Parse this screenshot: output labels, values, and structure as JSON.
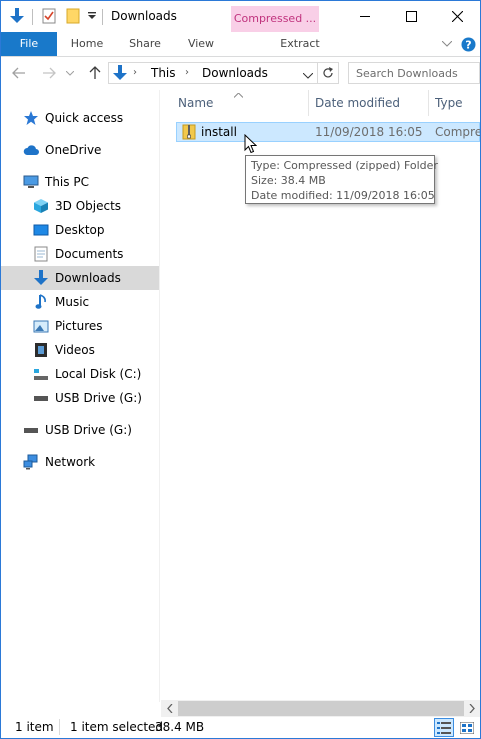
{
  "window": {
    "title": "Downloads"
  },
  "ribbon": {
    "context_tab": "Compressed ...",
    "tabs": [
      {
        "label": "File"
      },
      {
        "label": "Home"
      },
      {
        "label": "Share"
      },
      {
        "label": "View"
      },
      {
        "label": "Extract"
      }
    ]
  },
  "address": {
    "crumbs": [
      "This",
      "Downloads"
    ]
  },
  "search": {
    "placeholder": "Search Downloads"
  },
  "nav": {
    "items": [
      {
        "label": "Quick access",
        "icon": "star-icon"
      },
      {
        "label": "OneDrive",
        "icon": "cloud-icon"
      },
      {
        "label": "This PC",
        "icon": "computer-icon"
      },
      {
        "label": "3D Objects",
        "icon": "cube-icon"
      },
      {
        "label": "Desktop",
        "icon": "desktop-icon"
      },
      {
        "label": "Documents",
        "icon": "document-icon"
      },
      {
        "label": "Downloads",
        "icon": "download-icon",
        "selected": true
      },
      {
        "label": "Music",
        "icon": "music-icon"
      },
      {
        "label": "Pictures",
        "icon": "picture-icon"
      },
      {
        "label": "Videos",
        "icon": "video-icon"
      },
      {
        "label": "Local Disk (C:)",
        "icon": "disk-icon"
      },
      {
        "label": "USB Drive (G:)",
        "icon": "usb-drive-icon"
      },
      {
        "label": "USB Drive (G:)",
        "icon": "usb-drive-icon"
      },
      {
        "label": "Network",
        "icon": "network-icon"
      }
    ]
  },
  "columns": [
    {
      "label": "Name"
    },
    {
      "label": "Date modified"
    },
    {
      "label": "Type"
    }
  ],
  "files": [
    {
      "name": "install",
      "date": "11/09/2018 16:05",
      "type": "Compressed (zipped) Folder",
      "type_short": "Compres"
    }
  ],
  "tooltip": {
    "type_line": "Type: Compressed (zipped) Folder",
    "size_line": "Size: 38.4 MB",
    "date_line": "Date modified: 11/09/2018 16:05"
  },
  "status": {
    "count": "1 item",
    "selection": "1 item selected",
    "size": "38.4 MB"
  },
  "colors": {
    "accent": "#1979ca",
    "selection": "#cce8ff",
    "context_tab_bg": "#f9cfe7",
    "context_tab_text": "#c0337e",
    "nav_selected": "#d9d9d9"
  }
}
